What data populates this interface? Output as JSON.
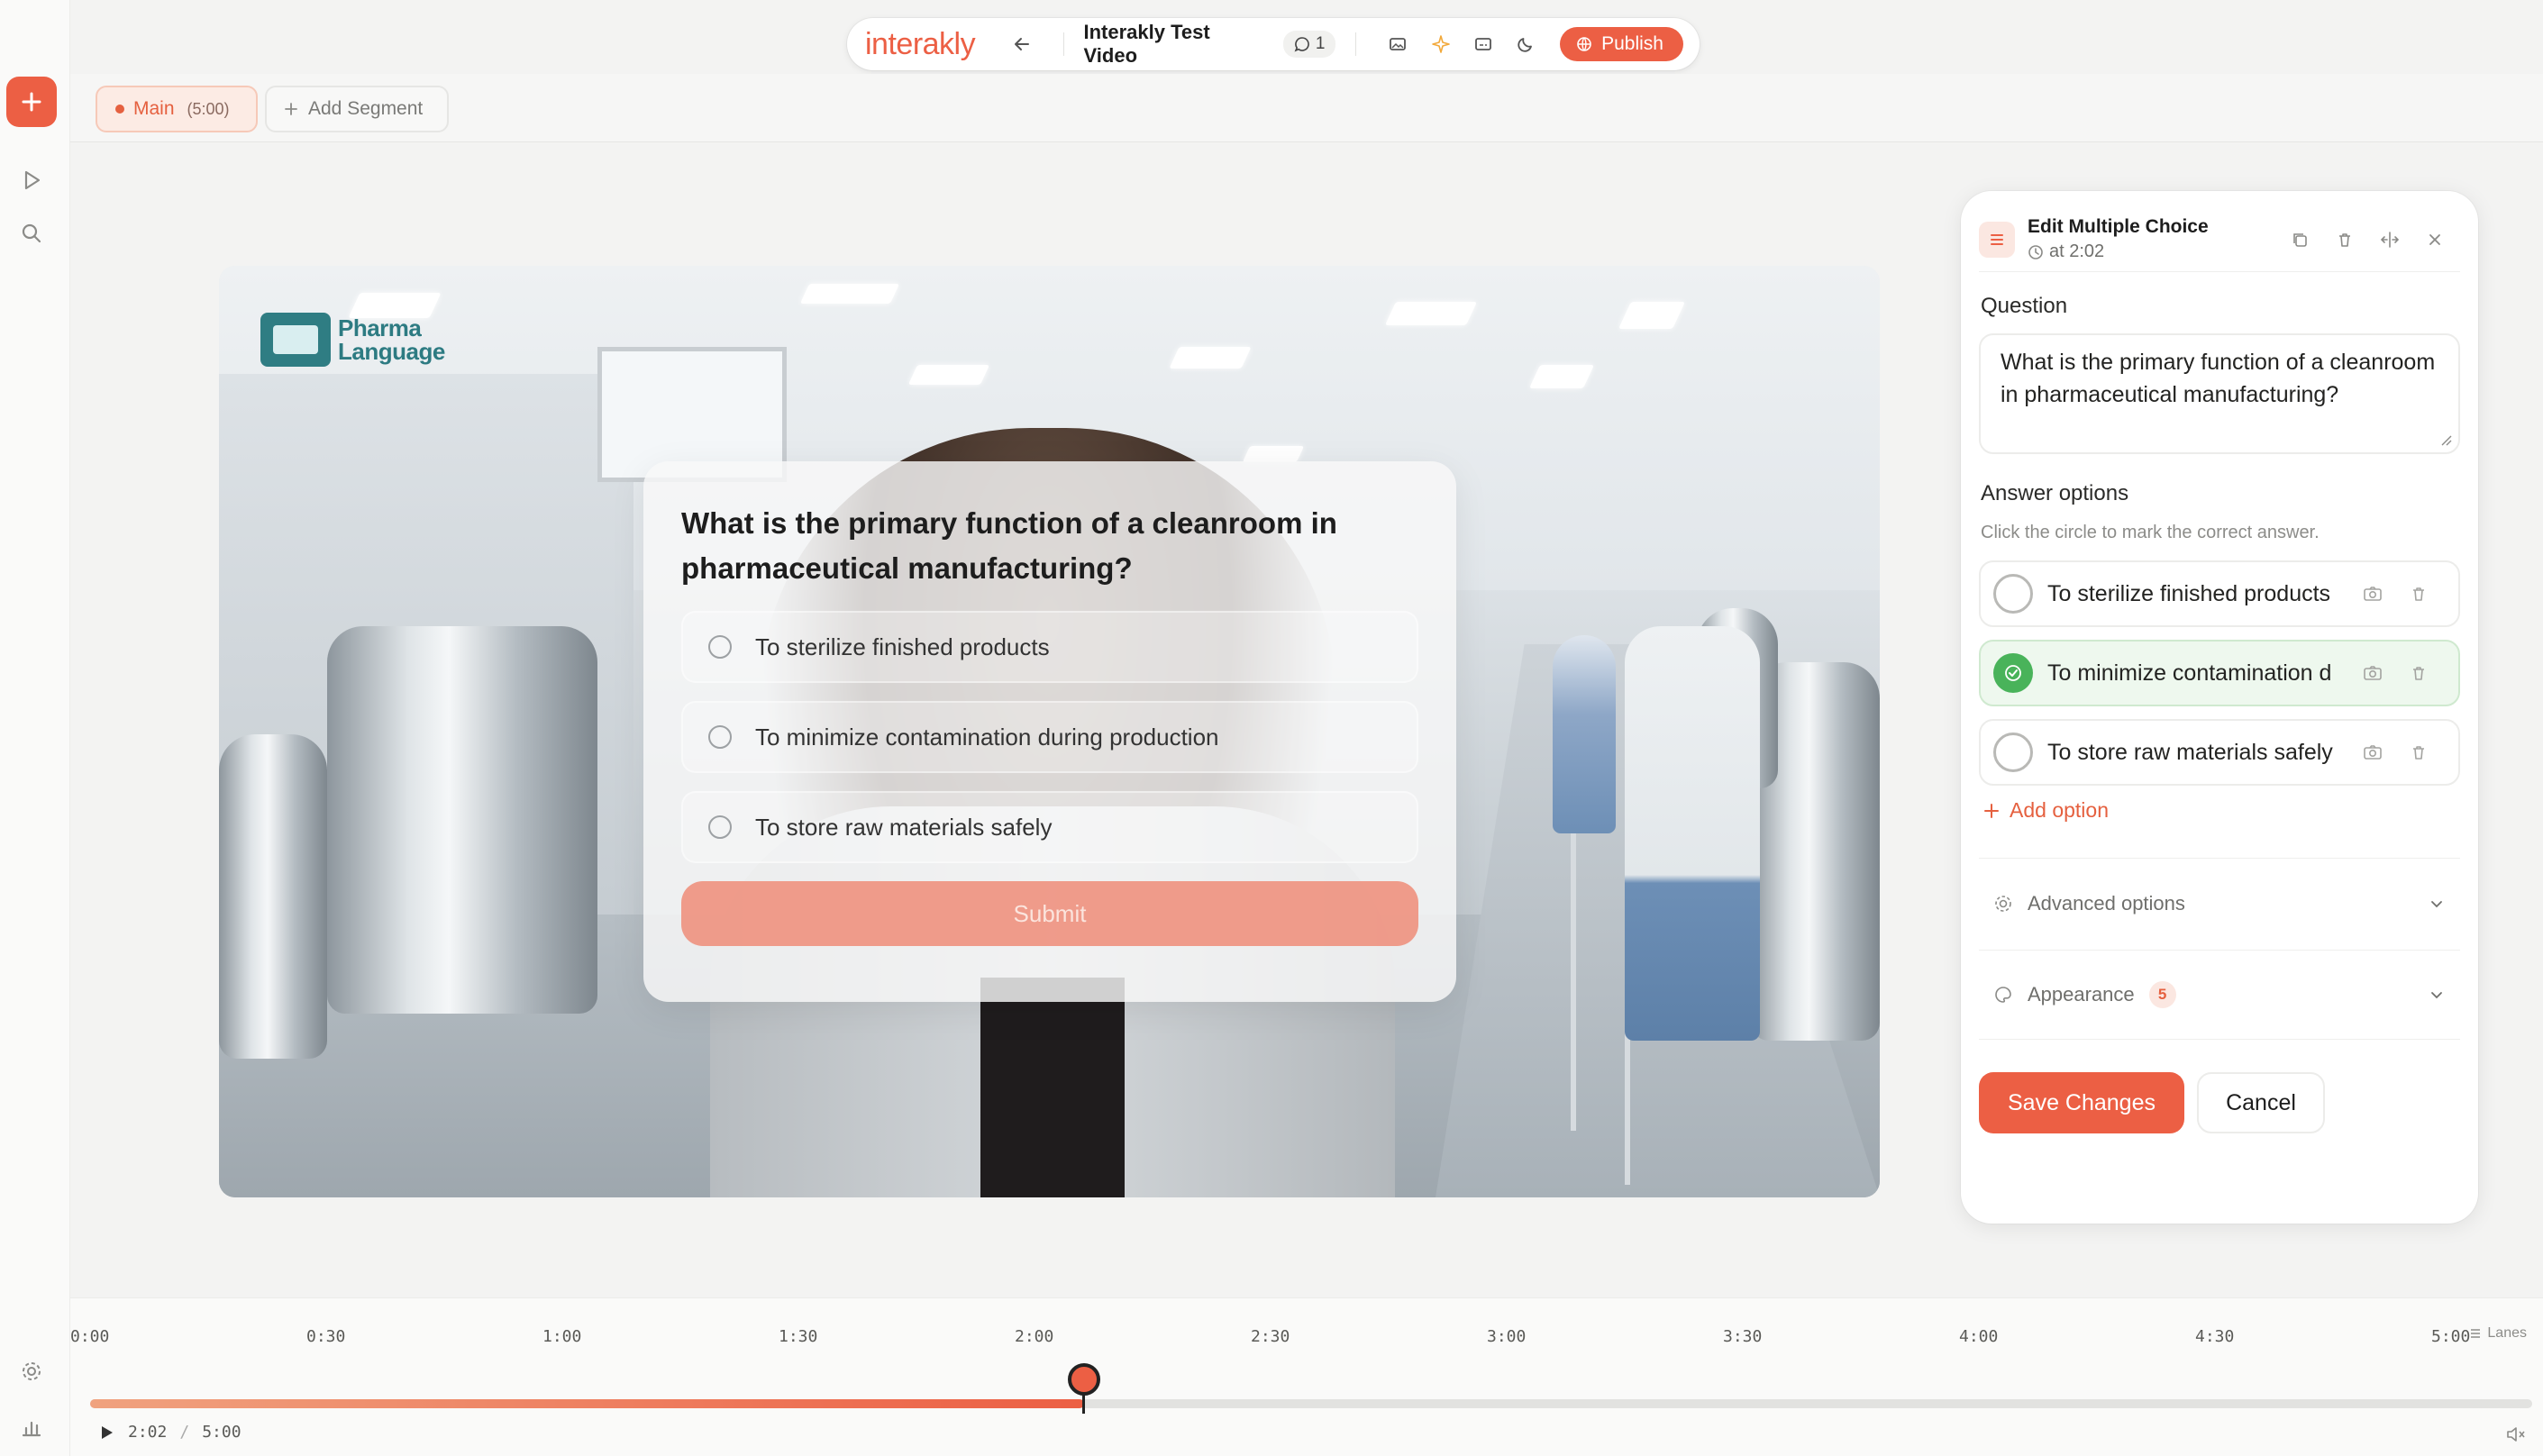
{
  "app": {
    "brand": "interakly",
    "video_title": "Interakly Test Video",
    "comment_count": "1",
    "publish_label": "Publish"
  },
  "segments": {
    "main_label": "Main",
    "main_duration": "(5:00)",
    "add_label": "Add Segment"
  },
  "video": {
    "logo_line1": "Pharma",
    "logo_line2": "Language"
  },
  "quiz": {
    "question": "What is the primary function of a cleanroom in pharmaceutical manufacturing?",
    "options": [
      "To sterilize finished products",
      "To minimize contamination during production",
      "To store raw materials safely"
    ],
    "submit_label": "Submit"
  },
  "panel": {
    "title": "Edit Multiple Choice",
    "time": "at 2:02",
    "question_label": "Question",
    "question_text": "What is the primary function of a cleanroom in pharmaceutical manufacturing?",
    "answers_label": "Answer options",
    "answers_hint": "Click the circle to mark the correct answer.",
    "answers": [
      {
        "text": "To sterilize finished products",
        "correct": false
      },
      {
        "text": "To minimize contamination d",
        "correct": true
      },
      {
        "text": "To store raw materials safely",
        "correct": false
      }
    ],
    "add_option_label": "Add option",
    "advanced_label": "Advanced options",
    "appearance_label": "Appearance",
    "appearance_badge": "5",
    "save_label": "Save Changes",
    "cancel_label": "Cancel"
  },
  "timeline": {
    "ticks": [
      "0:00",
      "0:30",
      "1:00",
      "1:30",
      "2:00",
      "2:30",
      "3:00",
      "3:30",
      "4:00",
      "4:30",
      "5:00"
    ],
    "lanes_label": "Lanes",
    "current_time": "2:02",
    "separator": "/",
    "total_time": "5:00",
    "progress_fraction": 0.407
  },
  "colors": {
    "accent": "#ec5f44",
    "correct": "#49b35a"
  }
}
